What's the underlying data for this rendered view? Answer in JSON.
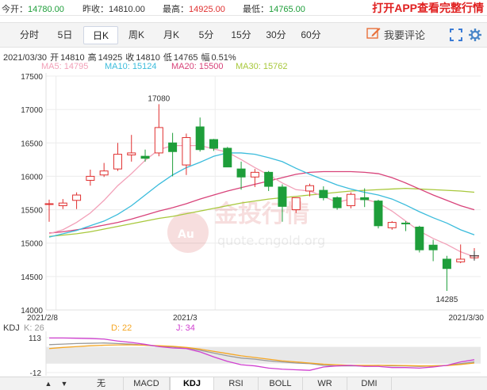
{
  "quote": {
    "open_label": "今开：",
    "open": "14780.00",
    "prev_label": "昨收：",
    "prev": "14810.00",
    "high_label": "最高：",
    "high": "14925.00",
    "low_label": "最低：",
    "low": "14765.00"
  },
  "app_link": "打开APP查看完整行情",
  "tabs": [
    "分时",
    "5日",
    "日K",
    "周K",
    "月K",
    "5分",
    "15分",
    "30分",
    "60分"
  ],
  "active_tab": "日K",
  "comment_label": "我要评论",
  "ohlc_line": {
    "date": "2021/03/30",
    "open_label": "开",
    "open": "14810",
    "high_label": "高",
    "high": "14925",
    "close_label": "收",
    "close": "14810",
    "low_label": "低",
    "low": "14765",
    "change_label": "幅",
    "change": "0.51%"
  },
  "ma_legend": {
    "ma5": "MA5: 14795",
    "ma10": "MA10: 15124",
    "ma20": "MA20: 15500",
    "ma30": "MA30: 15762"
  },
  "kdj_legend": {
    "title": "KDJ",
    "k": "K: 26",
    "d": "D: 22",
    "j": "J: 34"
  },
  "watermark": {
    "text": "金投行情",
    "url": "quote.cngold.org"
  },
  "bottom_tabs": [
    "无",
    "MACD",
    "KDJ",
    "RSI",
    "BOLL",
    "WR",
    "DMI"
  ],
  "active_bottom_tab": "KDJ",
  "colors": {
    "up": "#e03030",
    "down": "#1e9e3a",
    "ma5": "#f2a0b8",
    "ma10": "#3bbcdc",
    "ma20": "#d8437a",
    "ma30": "#a8c83c",
    "k": "#999999",
    "d": "#f5a623",
    "j": "#d040d0"
  },
  "chart_data": {
    "type": "candlestick",
    "y_ticks": [
      "17500",
      "17000",
      "16500",
      "16000",
      "15500",
      "15000",
      "14500",
      "14000"
    ],
    "ylim": [
      14000,
      17500
    ],
    "x_labels": [
      "2021/2/8",
      "2021/3",
      "2021/3/30"
    ],
    "max_label": "17080",
    "min_label": "14285",
    "candles": [
      {
        "o": 15590,
        "h": 15650,
        "l": 15320,
        "c": 15590
      },
      {
        "o": 15560,
        "h": 15660,
        "l": 15510,
        "c": 15600
      },
      {
        "o": 15640,
        "h": 15760,
        "l": 15510,
        "c": 15720
      },
      {
        "o": 15940,
        "h": 16100,
        "l": 15860,
        "c": 16000
      },
      {
        "o": 16020,
        "h": 16200,
        "l": 15990,
        "c": 16080
      },
      {
        "o": 16110,
        "h": 16500,
        "l": 16080,
        "c": 16330
      },
      {
        "o": 16320,
        "h": 16620,
        "l": 16220,
        "c": 16350
      },
      {
        "o": 16300,
        "h": 16400,
        "l": 16220,
        "c": 16270
      },
      {
        "o": 16350,
        "h": 17080,
        "l": 16300,
        "c": 16730
      },
      {
        "o": 16500,
        "h": 16650,
        "l": 16000,
        "c": 16370
      },
      {
        "o": 16170,
        "h": 16640,
        "l": 16020,
        "c": 16580
      },
      {
        "o": 16740,
        "h": 16880,
        "l": 16370,
        "c": 16400
      },
      {
        "o": 16550,
        "h": 16560,
        "l": 16380,
        "c": 16420
      },
      {
        "o": 16420,
        "h": 16440,
        "l": 16180,
        "c": 16140
      },
      {
        "o": 16110,
        "h": 16220,
        "l": 15800,
        "c": 15990
      },
      {
        "o": 15990,
        "h": 16110,
        "l": 15840,
        "c": 16060
      },
      {
        "o": 16060,
        "h": 16080,
        "l": 15780,
        "c": 15850
      },
      {
        "o": 15840,
        "h": 15880,
        "l": 15320,
        "c": 15550
      },
      {
        "o": 15500,
        "h": 15630,
        "l": 15450,
        "c": 15680
      },
      {
        "o": 15780,
        "h": 15890,
        "l": 15700,
        "c": 15860
      },
      {
        "o": 15790,
        "h": 15850,
        "l": 15640,
        "c": 15680
      },
      {
        "o": 15680,
        "h": 15700,
        "l": 15500,
        "c": 15530
      },
      {
        "o": 15560,
        "h": 15760,
        "l": 15520,
        "c": 15730
      },
      {
        "o": 15680,
        "h": 15820,
        "l": 15540,
        "c": 15650
      },
      {
        "o": 15630,
        "h": 15650,
        "l": 15220,
        "c": 15260
      },
      {
        "o": 15230,
        "h": 15330,
        "l": 15200,
        "c": 15310
      },
      {
        "o": 15300,
        "h": 15330,
        "l": 15180,
        "c": 15290
      },
      {
        "o": 15240,
        "h": 15260,
        "l": 14860,
        "c": 14900
      },
      {
        "o": 14970,
        "h": 15050,
        "l": 14730,
        "c": 14900
      },
      {
        "o": 14760,
        "h": 14810,
        "l": 14285,
        "c": 14620
      },
      {
        "o": 14720,
        "h": 14980,
        "l": 14700,
        "c": 14760
      },
      {
        "o": 14780,
        "h": 14925,
        "l": 14765,
        "c": 14810
      }
    ],
    "ma5": [
      15140,
      15200,
      15310,
      15450,
      15640,
      15860,
      16040,
      16240,
      16400,
      16460,
      16460,
      16460,
      16410,
      16360,
      16250,
      16130,
      16020,
      15900,
      15800,
      15780,
      15700,
      15610,
      15660,
      15660,
      15600,
      15480,
      15330,
      15180,
      15070,
      14980,
      14870,
      14795
    ],
    "ma10": [
      15090,
      15140,
      15190,
      15260,
      15330,
      15430,
      15560,
      15720,
      15880,
      16020,
      16130,
      16210,
      16300,
      16350,
      16350,
      16330,
      16280,
      16220,
      16120,
      16030,
      15950,
      15870,
      15810,
      15760,
      15720,
      15660,
      15570,
      15470,
      15380,
      15300,
      15200,
      15124
    ],
    "ma20": [
      15150,
      15170,
      15200,
      15230,
      15270,
      15310,
      15360,
      15420,
      15480,
      15530,
      15590,
      15660,
      15720,
      15780,
      15830,
      15880,
      15930,
      15980,
      16030,
      16060,
      16070,
      16070,
      16070,
      16060,
      16040,
      15980,
      15900,
      15810,
      15720,
      15640,
      15560,
      15500
    ],
    "ma30": [
      15100,
      15120,
      15140,
      15170,
      15210,
      15250,
      15290,
      15330,
      15370,
      15400,
      15440,
      15480,
      15520,
      15560,
      15600,
      15630,
      15660,
      15680,
      15700,
      15720,
      15740,
      15760,
      15780,
      15790,
      15800,
      15810,
      15820,
      15810,
      15800,
      15790,
      15780,
      15762
    ],
    "kdj_ylim": [
      -12,
      113
    ],
    "kdj_ticks": [
      "113",
      "-12"
    ],
    "kdj_k": [
      88,
      90,
      92,
      93,
      94,
      92,
      90,
      86,
      82,
      80,
      76,
      68,
      58,
      48,
      40,
      36,
      30,
      26,
      22,
      20,
      14,
      12,
      12,
      12,
      14,
      12,
      12,
      10,
      12,
      14,
      20,
      26
    ],
    "kdj_d": [
      74,
      78,
      81,
      84,
      86,
      87,
      87,
      86,
      84,
      82,
      78,
      72,
      64,
      56,
      48,
      42,
      36,
      30,
      26,
      22,
      18,
      16,
      14,
      14,
      14,
      14,
      13,
      12,
      12,
      13,
      17,
      22
    ],
    "kdj_j": [
      112,
      112,
      111,
      110,
      108,
      101,
      96,
      89,
      81,
      76,
      74,
      62,
      44,
      28,
      16,
      12,
      4,
      0,
      -2,
      -4,
      8,
      12,
      14,
      10,
      10,
      6,
      6,
      4,
      8,
      14,
      26,
      34
    ]
  }
}
